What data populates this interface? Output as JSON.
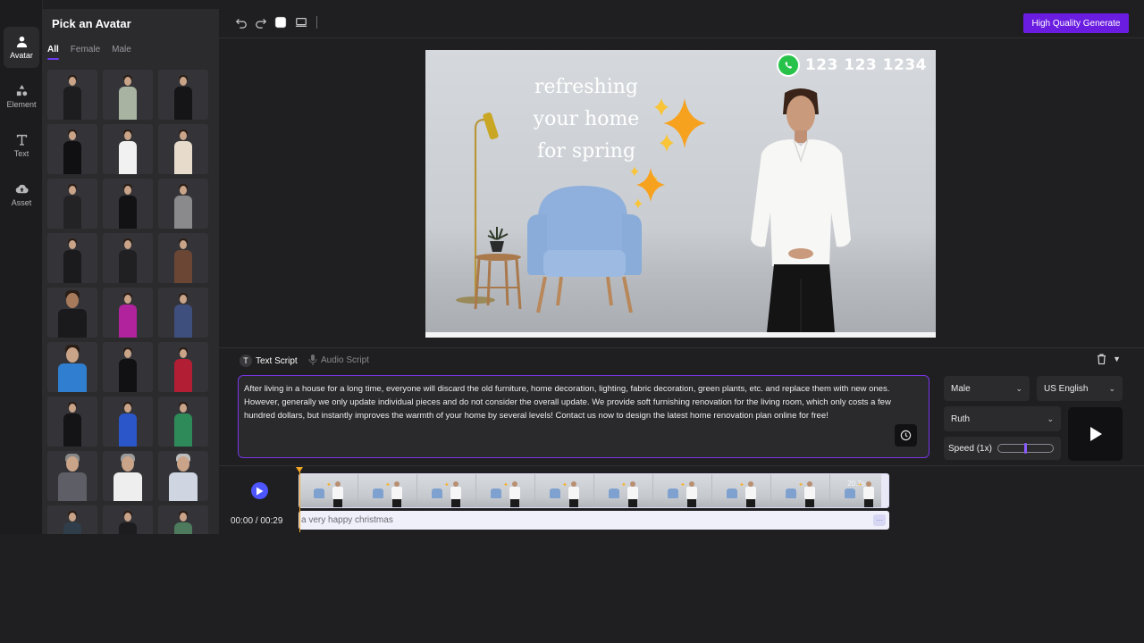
{
  "rail": {
    "items": [
      {
        "label": "Avatar",
        "icon": "user-icon",
        "active": true
      },
      {
        "label": "Element",
        "icon": "shapes-icon",
        "active": false
      },
      {
        "label": "Text",
        "icon": "text-icon",
        "active": false
      },
      {
        "label": "Asset",
        "icon": "cloud-upload-icon",
        "active": false
      }
    ]
  },
  "panel": {
    "title": "Pick an Avatar",
    "tabs": [
      {
        "label": "All",
        "active": true
      },
      {
        "label": "Female",
        "active": false
      },
      {
        "label": "Male",
        "active": false
      }
    ]
  },
  "toolbar": {
    "generate_label": "High Quality Generate",
    "accent": "#6a1de0"
  },
  "preview": {
    "slogan_line1": "refreshing",
    "slogan_line2": "your home",
    "slogan_line3": "for spring",
    "phone": "123 123 1234"
  },
  "script": {
    "tab_text": "Text Script",
    "tab_audio": "Audio Script",
    "body": "After living in a house for a long time, everyone will discard the old furniture, home decoration, lighting, fabric decoration, green plants, etc. and replace them with new ones. However, generally we only update individual pieces and do not consider the overall update. We provide soft furnishing renovation for the living room, which only costs a few hundred dollars, but instantly improves the warmth of your home by several levels! Contact us now to design the latest home renovation plan online for free!",
    "gender_value": "Male",
    "language_value": "US English",
    "voice_value": "Ruth",
    "speed_label": "Speed (1x)"
  },
  "timeline": {
    "timecode": "00:00 / 00:29",
    "clip_duration": "20.7s",
    "caption": "a very happy christmas",
    "caption_more": "···"
  }
}
